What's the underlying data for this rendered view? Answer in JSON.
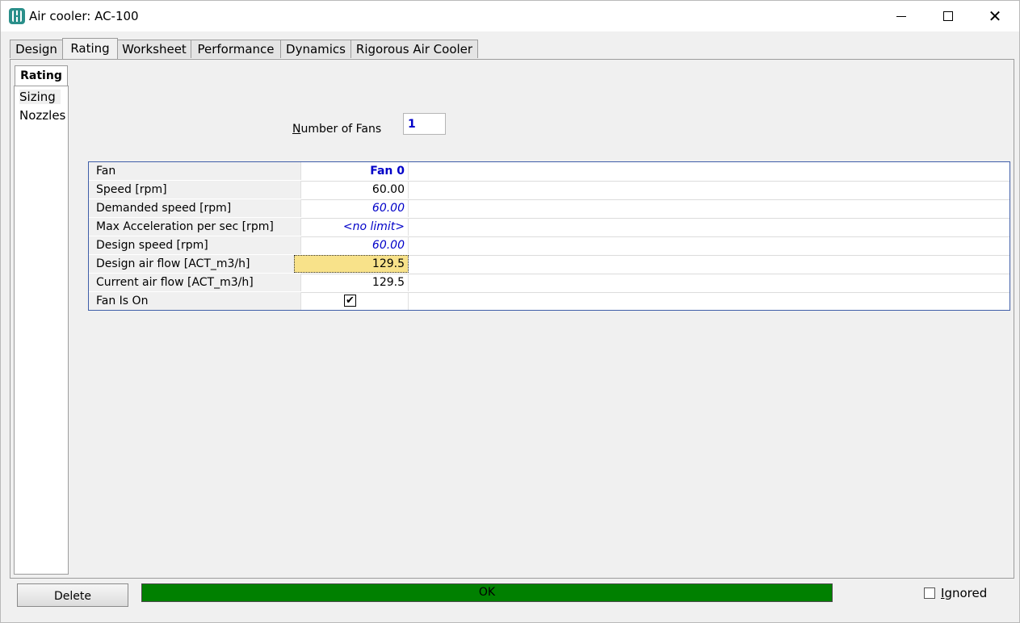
{
  "window": {
    "title": "Air cooler: AC-100",
    "controls": {
      "minimize": "minimize-icon",
      "maximize": "maximize-icon",
      "close": "close-icon"
    }
  },
  "tabs": [
    {
      "label": "Design",
      "active": false
    },
    {
      "label": "Rating",
      "active": true
    },
    {
      "label": "Worksheet",
      "active": false
    },
    {
      "label": "Performance",
      "active": false
    },
    {
      "label": "Dynamics",
      "active": false
    },
    {
      "label": "Rigorous Air Cooler",
      "active": false
    }
  ],
  "subtab": {
    "label": "Rating"
  },
  "sidenav": {
    "items": [
      {
        "label": "Sizing",
        "selected": true
      },
      {
        "label": "Nozzles",
        "selected": false
      }
    ]
  },
  "fans": {
    "label_accel": "N",
    "label_rest": "umber of Fans",
    "value": "1"
  },
  "grid": {
    "header_label": "Fan",
    "header_value": "Fan 0",
    "rows": [
      {
        "label": "Speed [rpm]",
        "value": "60.00"
      },
      {
        "label": "Demanded speed [rpm]",
        "value": "60.00"
      },
      {
        "label": "Max Acceleration per sec [rpm]",
        "value": "<no limit>"
      },
      {
        "label": "Design speed [rpm]",
        "value": "60.00"
      },
      {
        "label": "Design air flow [ACT_m3/h]",
        "value": "129.5"
      },
      {
        "label": "Current air flow [ACT_m3/h]",
        "value": "129.5"
      },
      {
        "label": "Fan Is On",
        "checked": true,
        "check_mark": "✔"
      }
    ]
  },
  "footer": {
    "delete_label": "Delete",
    "status_text": "OK",
    "status_color": "#008000",
    "ignored_accel": "I",
    "ignored_rest": "gnored",
    "ignored_checked": false
  }
}
